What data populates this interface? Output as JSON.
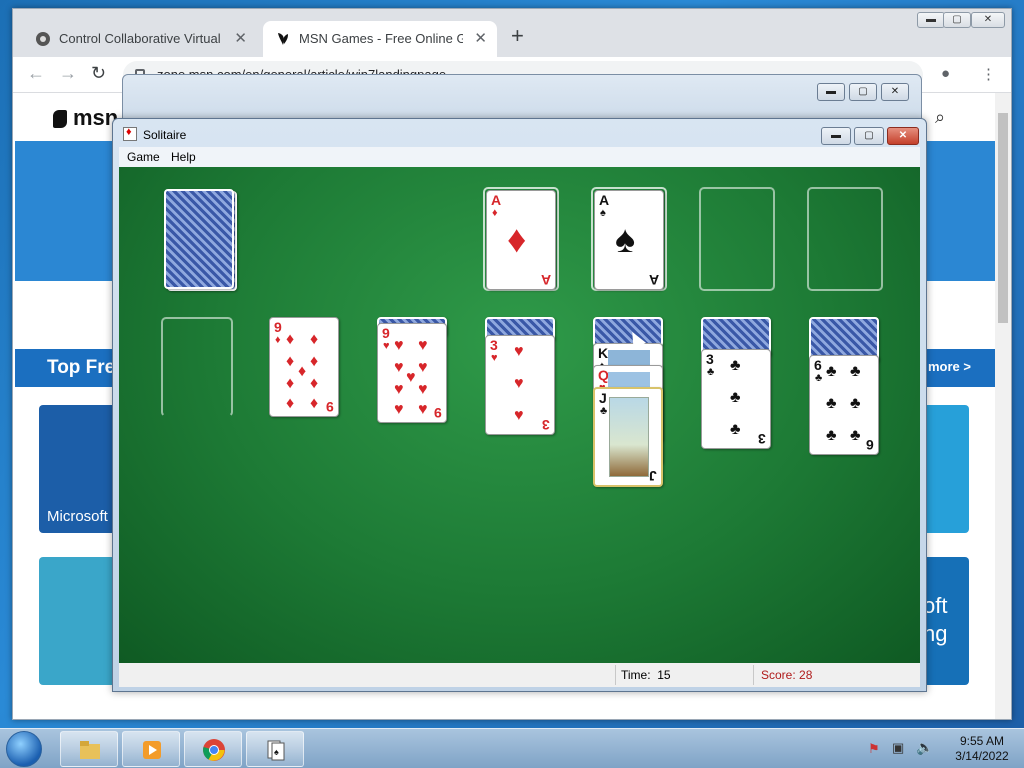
{
  "browser": {
    "tabs": [
      {
        "label": "Control Collaborative Virtual Ma",
        "active": false
      },
      {
        "label": "MSN Games - Free Online Games",
        "active": true
      }
    ],
    "url": "zone.msn.com/en/general/article/win7landingpage"
  },
  "msn_page": {
    "logo": "msn",
    "section_title": "Top Fre",
    "more_link": "more >",
    "tile_caption_left": "Microsoft",
    "tile_caption_right_1": "oft",
    "tile_caption_right_2": "ng"
  },
  "solitaire": {
    "title": "Solitaire",
    "menu": [
      "Game",
      "Help"
    ],
    "status": {
      "time_label": "Time:",
      "time_value": "15",
      "score_label": "Score: 28"
    },
    "foundations": [
      {
        "rank": "A",
        "suit": "♦"
      },
      {
        "rank": "A",
        "suit": "♠"
      },
      {
        "rank": "",
        "suit": ""
      },
      {
        "rank": "",
        "suit": ""
      }
    ],
    "tableau": [
      {
        "face_up": []
      },
      {
        "face_up": [
          {
            "rank": "9",
            "suit": "♦"
          }
        ]
      },
      {
        "face_up": [
          {
            "rank": "9",
            "suit": "♥"
          }
        ]
      },
      {
        "face_up": [
          {
            "rank": "3",
            "suit": "♥"
          }
        ]
      },
      {
        "face_up": [
          {
            "rank": "K",
            "suit": "♠"
          },
          {
            "rank": "Q",
            "suit": "♥"
          },
          {
            "rank": "J",
            "suit": "♣"
          }
        ]
      },
      {
        "face_up": [
          {
            "rank": "3",
            "suit": "♣"
          }
        ]
      },
      {
        "face_up": [
          {
            "rank": "6",
            "suit": "♣"
          }
        ]
      }
    ]
  },
  "taskbar": {
    "clock_time": "9:55 AM",
    "clock_date": "3/14/2022"
  },
  "colors": {
    "felt": "#1d7a35",
    "red_suit": "#d7262a",
    "score": "#b01b1b"
  }
}
